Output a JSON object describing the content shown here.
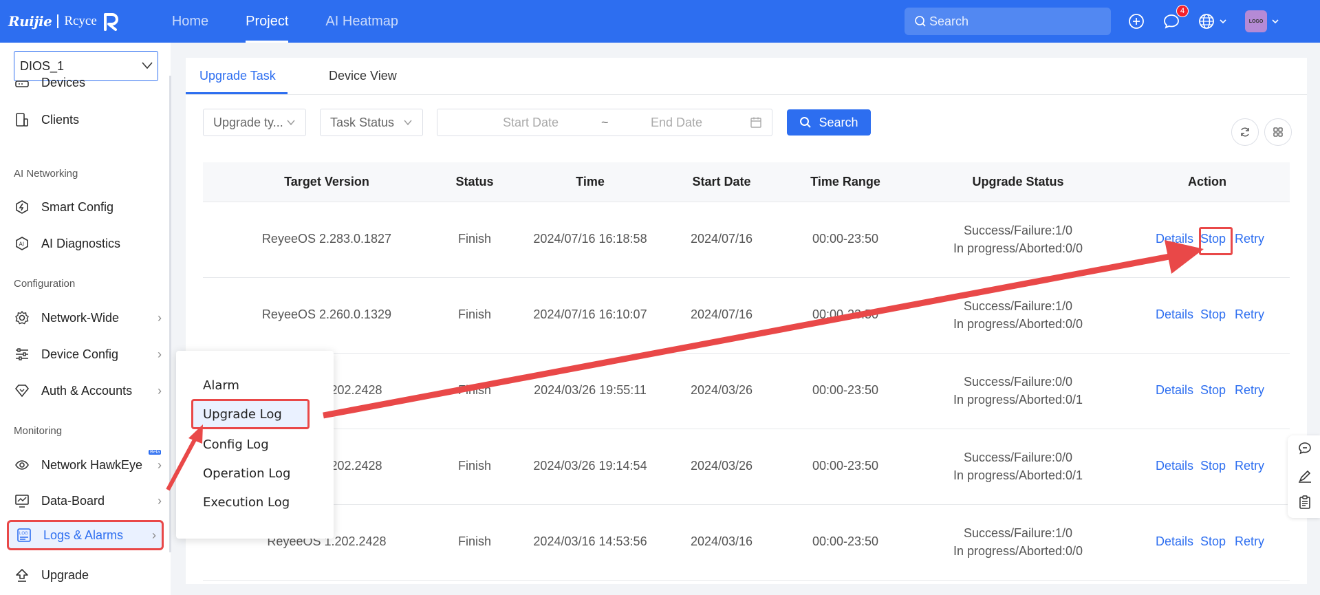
{
  "topbar": {
    "logo_brand": "Ruijie",
    "logo_product": "Rcyce",
    "nav": [
      "Home",
      "Project",
      "AI Heatmap"
    ],
    "active_nav": "Project",
    "search_placeholder": "Search",
    "notification_count": "4",
    "avatar_text": "LOGO"
  },
  "sidebar": {
    "site": "DIOS_1",
    "items": {
      "devices": "Devices",
      "clients": "Clients",
      "section_ai": "AI Networking",
      "smart_config": "Smart Config",
      "ai_diagnostics": "AI Diagnostics",
      "section_config": "Configuration",
      "network_wide": "Network-Wide",
      "device_config": "Device Config",
      "auth_accounts": "Auth & Accounts",
      "section_monitoring": "Monitoring",
      "network_hawkeye": "Network HawkEye",
      "beta": "Beta",
      "data_board": "Data-Board",
      "logs_alarms": "Logs & Alarms",
      "upgrade": "Upgrade"
    }
  },
  "logs_menu": {
    "items": [
      "Alarm",
      "Upgrade Log",
      "Config Log",
      "Operation Log",
      "Execution Log"
    ],
    "selected": "Upgrade Log"
  },
  "main": {
    "tabs": [
      "Upgrade Task",
      "Device View"
    ],
    "active_tab": "Upgrade Task",
    "filters": {
      "upgrade_type": "Upgrade ty...",
      "task_status": "Task Status",
      "start_date": "Start Date",
      "date_sep": "~",
      "end_date": "End Date",
      "search_button": "Search"
    },
    "table": {
      "headers": [
        "Target Version",
        "Status",
        "Time",
        "Start Date",
        "Time Range",
        "Upgrade Status",
        "Action"
      ],
      "rows": [
        {
          "version": "ReyeeOS 2.283.0.1827",
          "status": "Finish",
          "time": "2024/07/16 16:18:58",
          "start": "2024/07/16",
          "range": "00:00-23:50",
          "us1": "Success/Failure:1/0",
          "us2": "In progress/Aborted:0/0"
        },
        {
          "version": "ReyeeOS 2.260.0.1329",
          "status": "Finish",
          "time": "2024/07/16 16:10:07",
          "start": "2024/07/16",
          "range": "00:00-23:50",
          "us1": "Success/Failure:1/0",
          "us2": "In progress/Aborted:0/0"
        },
        {
          "version": "202.2428",
          "status": "Finish",
          "time": "2024/03/26 19:55:11",
          "start": "2024/03/26",
          "range": "00:00-23:50",
          "us1": "Success/Failure:0/0",
          "us2": "In progress/Aborted:0/1"
        },
        {
          "version": "202.2428",
          "status": "Finish",
          "time": "2024/03/26 19:14:54",
          "start": "2024/03/26",
          "range": "00:00-23:50",
          "us1": "Success/Failure:0/0",
          "us2": "In progress/Aborted:0/1"
        },
        {
          "version": "ReyeeOS 1.202.2428",
          "status": "Finish",
          "time": "2024/03/16 14:53:56",
          "start": "2024/03/16",
          "range": "00:00-23:50",
          "us1": "Success/Failure:1/0",
          "us2": "In progress/Aborted:0/0"
        }
      ],
      "actions": {
        "details": "Details",
        "stop": "Stop",
        "retry": "Retry"
      }
    }
  },
  "colors": {
    "primary": "#2d6ef0",
    "annotation": "#e94848"
  }
}
